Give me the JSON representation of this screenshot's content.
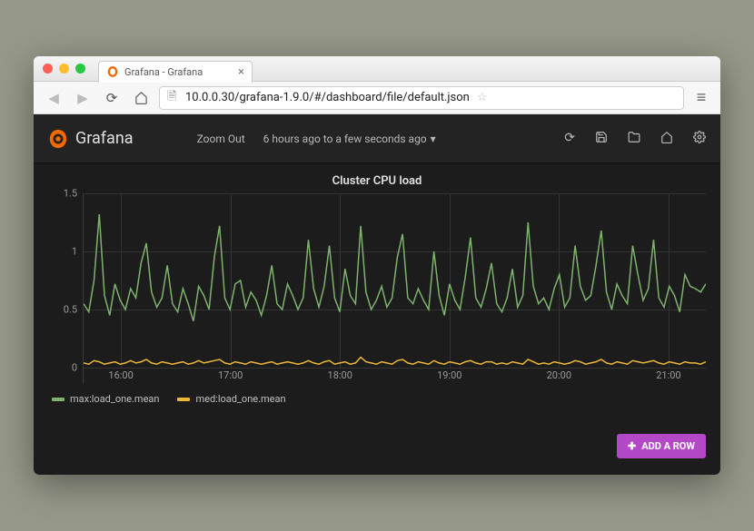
{
  "browser": {
    "tab_title": "Grafana - Grafana",
    "url": "10.0.0.30/grafana-1.9.0/#/dashboard/file/default.json"
  },
  "app": {
    "brand": "Grafana",
    "zoom_out": "Zoom Out",
    "timerange": "6 hours ago to a few seconds ago",
    "add_row": "ADD A ROW"
  },
  "chart_data": {
    "type": "line",
    "title": "Cluster CPU load",
    "ylim": [
      0,
      1.5
    ],
    "y_ticks": [
      0,
      0.5,
      1.0,
      1.5
    ],
    "x_categories": [
      "16:00",
      "17:00",
      "18:00",
      "19:00",
      "20:00",
      "21:00"
    ],
    "colors": {
      "max": "#7eb26d",
      "med": "#eab839"
    },
    "series": [
      {
        "name": "max:load_one.mean",
        "color_key": "max",
        "values": [
          0.55,
          0.48,
          0.75,
          1.32,
          0.62,
          0.45,
          0.72,
          0.58,
          0.5,
          0.68,
          0.6,
          0.9,
          1.07,
          0.65,
          0.52,
          0.6,
          0.88,
          0.55,
          0.48,
          0.68,
          0.55,
          0.4,
          0.7,
          0.62,
          0.5,
          0.95,
          1.22,
          0.6,
          0.5,
          0.72,
          0.75,
          0.52,
          0.65,
          0.58,
          0.45,
          0.62,
          0.88,
          0.55,
          0.5,
          0.72,
          0.62,
          0.5,
          0.6,
          1.1,
          0.68,
          0.52,
          0.7,
          1.05,
          0.6,
          0.48,
          0.85,
          0.62,
          0.55,
          1.22,
          0.65,
          0.5,
          0.58,
          0.7,
          0.52,
          0.6,
          0.95,
          1.15,
          0.6,
          0.55,
          0.68,
          0.58,
          0.5,
          1.0,
          0.62,
          0.45,
          0.72,
          0.58,
          0.5,
          0.78,
          1.12,
          0.6,
          0.52,
          0.68,
          0.9,
          0.55,
          0.48,
          0.6,
          0.85,
          0.52,
          0.62,
          1.25,
          0.7,
          0.55,
          0.6,
          0.5,
          0.68,
          0.8,
          0.52,
          0.6,
          1.05,
          0.7,
          0.58,
          0.62,
          0.88,
          1.18,
          0.65,
          0.5,
          0.72,
          0.62,
          0.55,
          1.05,
          0.8,
          0.58,
          0.68,
          1.1,
          0.6,
          0.52,
          0.7,
          0.62,
          0.48,
          0.8,
          0.7,
          0.68,
          0.65,
          0.72
        ]
      },
      {
        "name": "med:load_one.mean",
        "color_key": "med",
        "values": [
          0.04,
          0.03,
          0.06,
          0.05,
          0.03,
          0.04,
          0.05,
          0.03,
          0.04,
          0.06,
          0.04,
          0.05,
          0.07,
          0.04,
          0.03,
          0.05,
          0.04,
          0.03,
          0.04,
          0.05,
          0.03,
          0.04,
          0.06,
          0.04,
          0.05,
          0.06,
          0.07,
          0.04,
          0.03,
          0.05,
          0.04,
          0.03,
          0.05,
          0.04,
          0.03,
          0.04,
          0.05,
          0.03,
          0.04,
          0.05,
          0.04,
          0.03,
          0.04,
          0.06,
          0.04,
          0.03,
          0.05,
          0.06,
          0.03,
          0.04,
          0.05,
          0.03,
          0.04,
          0.09,
          0.05,
          0.04,
          0.03,
          0.05,
          0.04,
          0.03,
          0.06,
          0.07,
          0.04,
          0.03,
          0.05,
          0.04,
          0.03,
          0.06,
          0.04,
          0.03,
          0.05,
          0.04,
          0.03,
          0.05,
          0.06,
          0.04,
          0.03,
          0.05,
          0.05,
          0.03,
          0.04,
          0.03,
          0.05,
          0.04,
          0.03,
          0.07,
          0.05,
          0.03,
          0.04,
          0.03,
          0.05,
          0.04,
          0.03,
          0.04,
          0.06,
          0.05,
          0.03,
          0.04,
          0.05,
          0.07,
          0.04,
          0.03,
          0.05,
          0.04,
          0.03,
          0.06,
          0.05,
          0.04,
          0.05,
          0.06,
          0.04,
          0.03,
          0.05,
          0.04,
          0.03,
          0.05,
          0.04,
          0.04,
          0.03,
          0.05
        ]
      }
    ]
  }
}
